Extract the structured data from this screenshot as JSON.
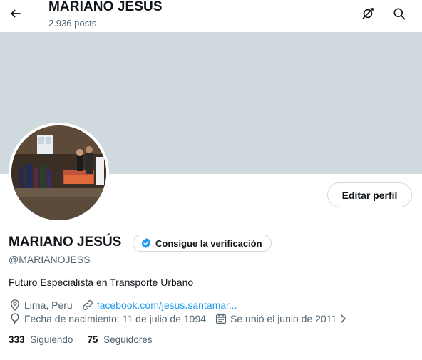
{
  "header": {
    "title": "MARIANO JESÚS",
    "post_count": "2.936 posts"
  },
  "profile": {
    "name": "MARIANO JESÚS",
    "handle": "@MARIANOJESS",
    "bio": "Futuro Especialista en Transporte Urbano",
    "edit_button": "Editar perfil",
    "verify_button": "Consigue la verificación",
    "location": "Lima, Peru",
    "website": "facebook.com/jesus.santamar...",
    "birthday": "Fecha de nacimiento: 11 de julio de 1994",
    "joined": "Se unió el junio de 2011",
    "following_count": "333",
    "following_label": "Siguiendo",
    "followers_count": "75",
    "followers_label": "Seguidores"
  },
  "colors": {
    "banner": "#cfd9de",
    "link": "#1d9bf0",
    "secondary_text": "#536471",
    "verified_badge": "#1d9bf0"
  },
  "icons": {
    "back": "arrow-left-icon",
    "grok": "grok-icon",
    "search": "search-icon",
    "verified": "verified-badge-icon",
    "location": "map-pin-icon",
    "website": "link-icon",
    "birthday": "balloon-icon",
    "joined": "calendar-icon",
    "more": "chevron-right-icon"
  }
}
